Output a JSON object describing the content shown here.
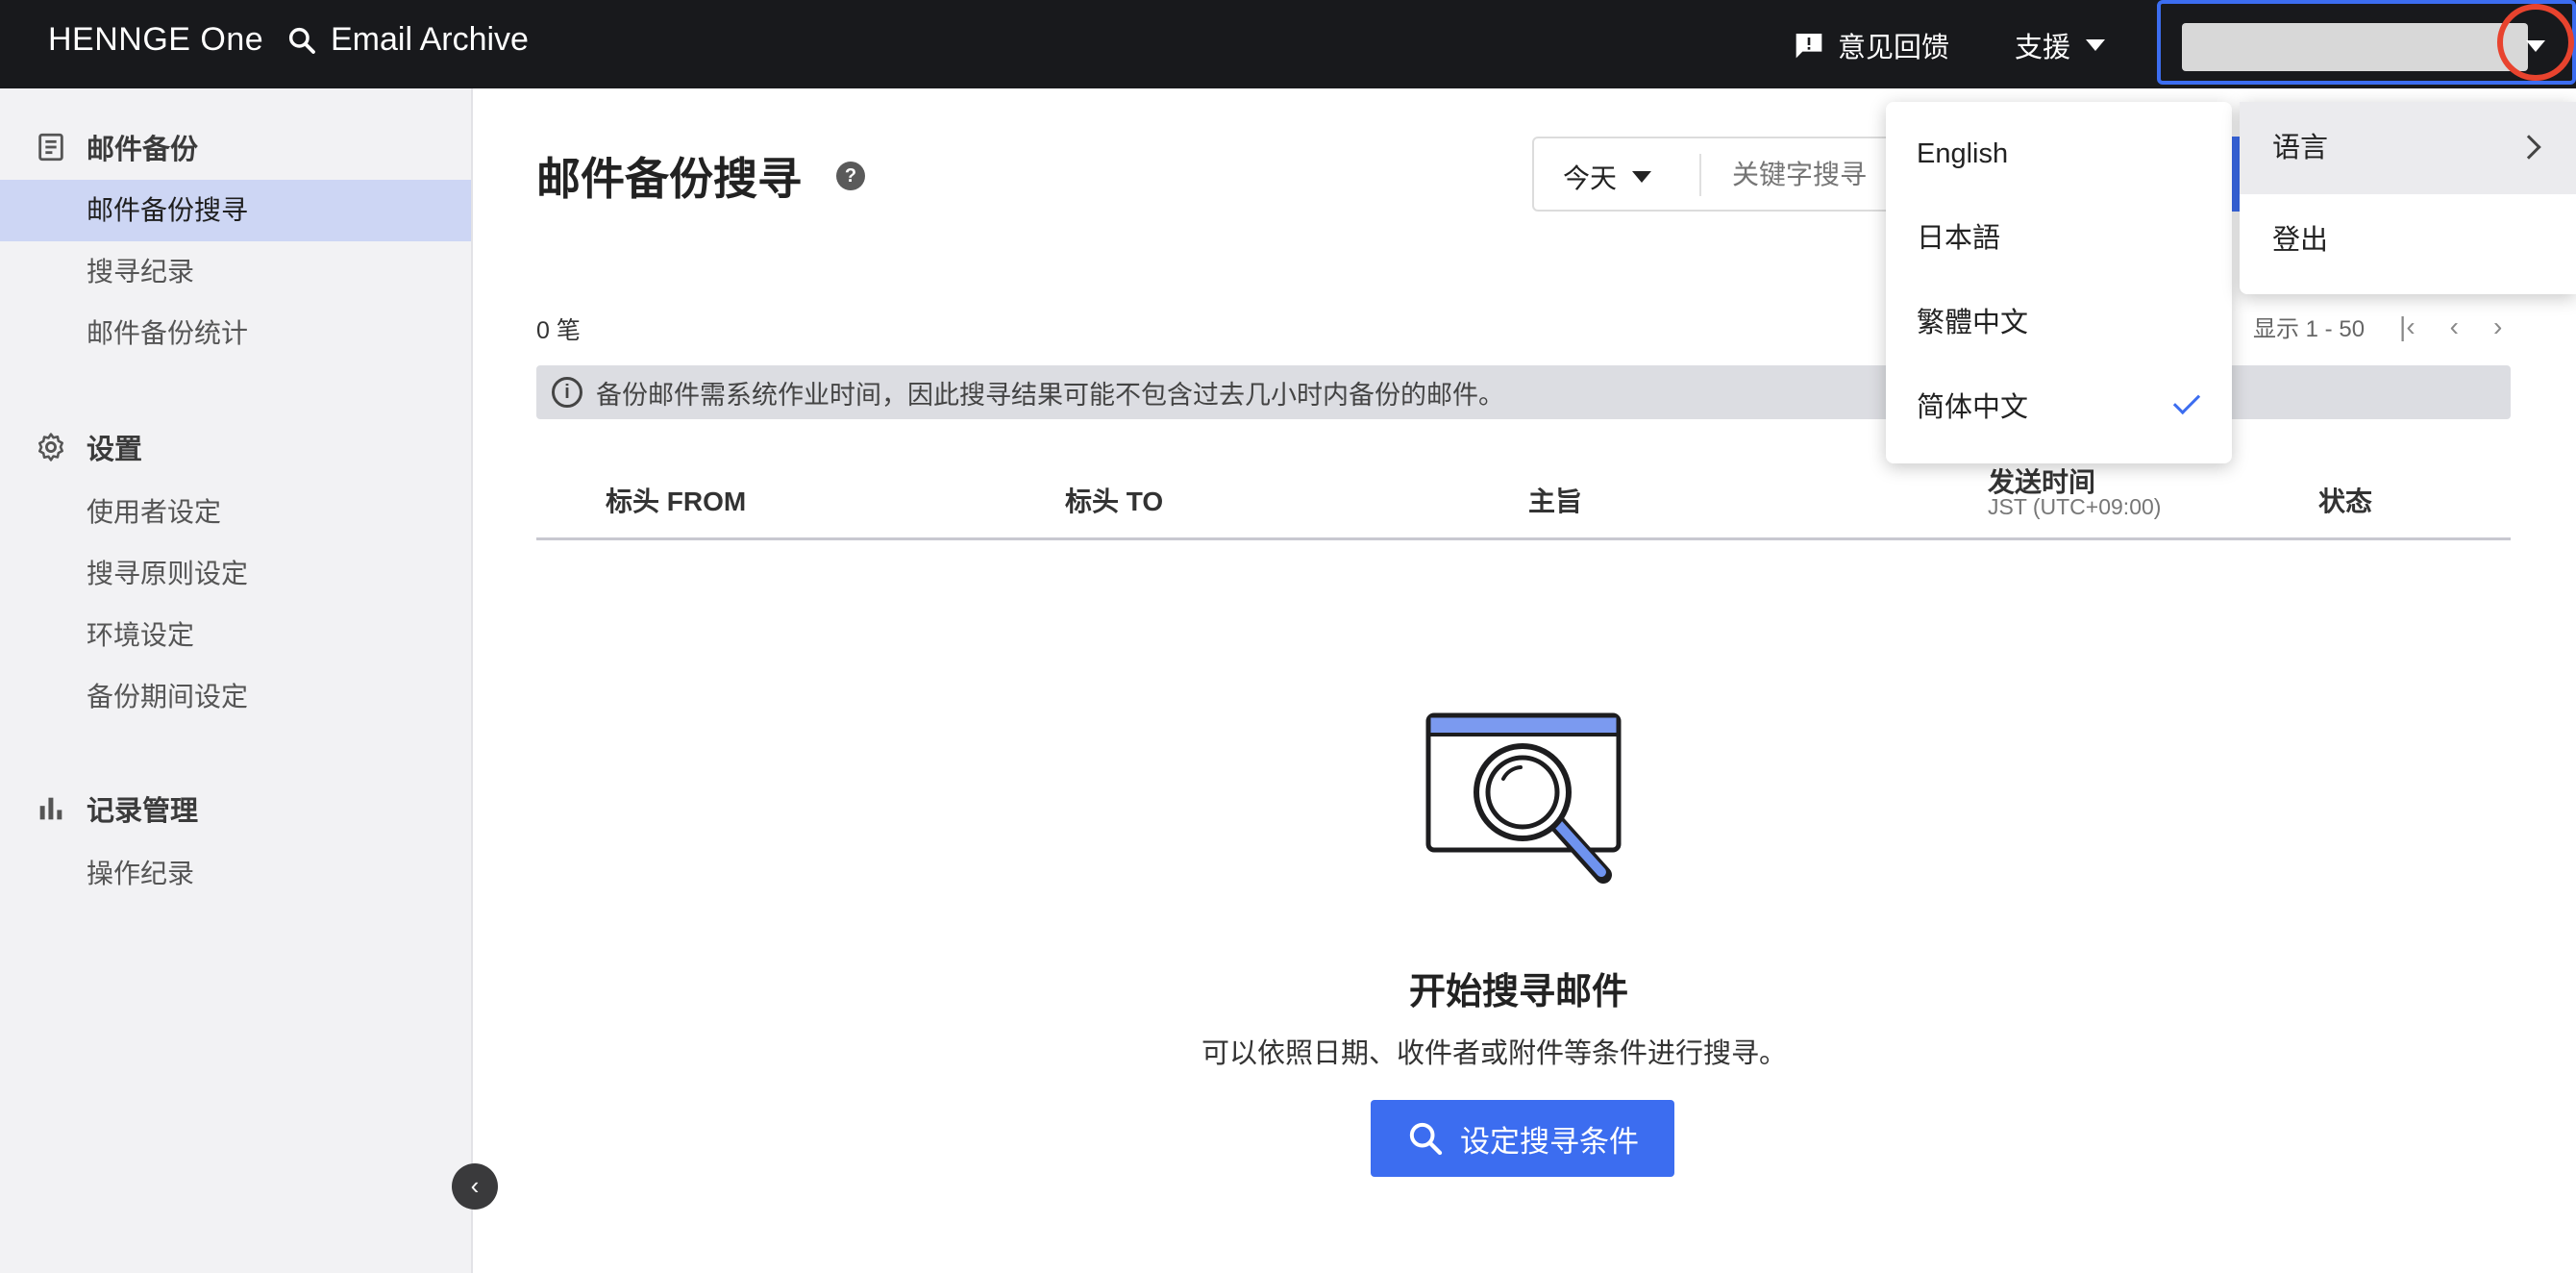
{
  "header": {
    "brand": "HENNGE One",
    "product": "Email Archive",
    "feedback": "意见回馈",
    "support": "支援"
  },
  "sidebar": {
    "sections": [
      {
        "title": "邮件备份",
        "icon": "document-list-icon",
        "items": [
          "邮件备份搜寻",
          "搜寻纪录",
          "邮件备份统计"
        ]
      },
      {
        "title": "设置",
        "icon": "gear-icon",
        "items": [
          "使用者设定",
          "搜寻原则设定",
          "环境设定",
          "备份期间设定"
        ]
      },
      {
        "title": "记录管理",
        "icon": "bar-chart-icon",
        "items": [
          "操作纪录"
        ]
      }
    ],
    "active_item": "邮件备份搜寻"
  },
  "main": {
    "title": "邮件备份搜寻",
    "date_filter": "今天",
    "keyword_placeholder": "关键字搜寻",
    "count": "0 笔",
    "pager": "显示 1 - 50",
    "notice": "备份邮件需系统作业时间，因此搜寻结果可能不包含过去几小时内备份的邮件。",
    "columns": {
      "from": "标头 FROM",
      "to": "标头 TO",
      "subject": "主旨",
      "sent": "发送时间",
      "sent_tz": "JST (UTC+09:00)",
      "status": "状态"
    },
    "empty": {
      "title": "开始搜寻邮件",
      "subtitle": "可以依照日期、收件者或附件等条件进行搜寻。",
      "button": "设定搜寻条件"
    }
  },
  "language_menu": {
    "items": [
      "English",
      "日本語",
      "繁體中文",
      "简体中文"
    ],
    "selected": "简体中文"
  },
  "user_menu": {
    "language": "语言",
    "logout": "登出"
  },
  "colors": {
    "accent": "#3c6df0",
    "highlight_ring": "#e8432e",
    "topbar": "#18191c"
  }
}
